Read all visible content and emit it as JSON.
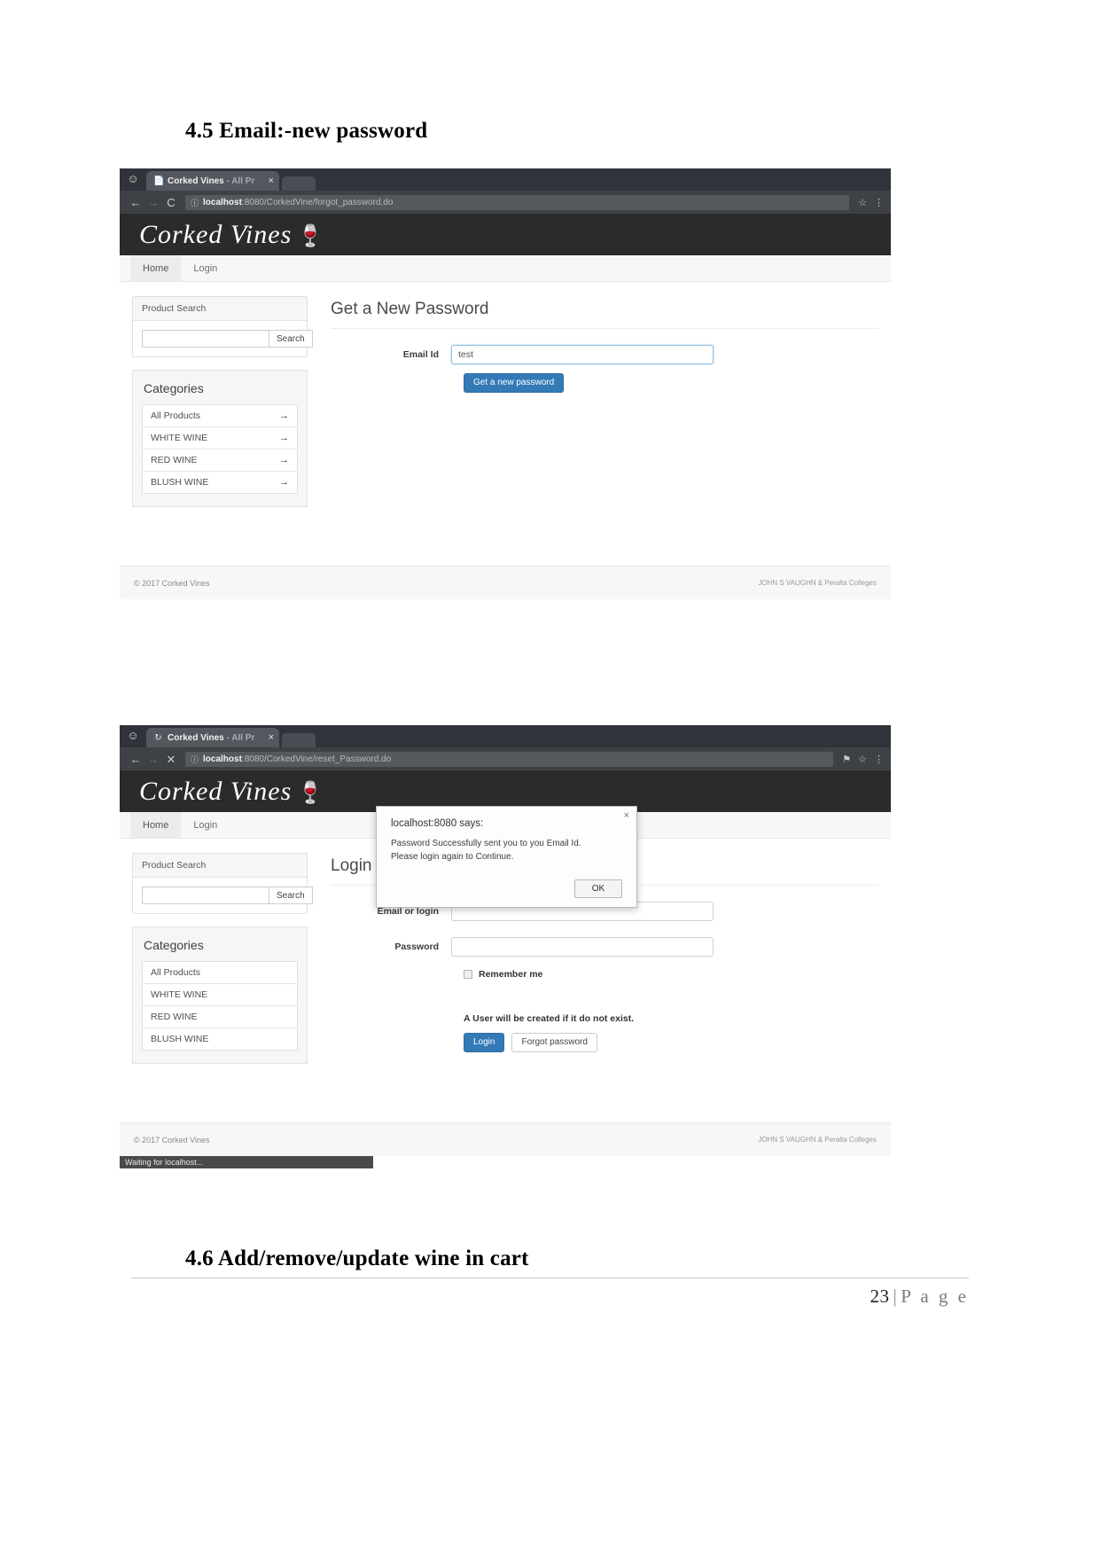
{
  "document": {
    "heading_45": "4.5 Email:-new password",
    "heading_46": "4.6 Add/remove/update wine in cart",
    "page_number": "23",
    "page_separator": "|",
    "page_word": "P a g e"
  },
  "screenshot_one": {
    "chrome": {
      "incognito_icon": "incognito-icon",
      "tab_title_main": "Corked Vines",
      "tab_title_sub": " - All Pr",
      "tab_close_label": "×",
      "back_icon": "←",
      "forward_icon": "→",
      "reload_icon": "C",
      "info_icon": "ⓘ",
      "url_host": "localhost",
      "url_path": ":8080/CorkedVine/forgot_password.do",
      "star_icon": "☆",
      "menu_icon": "⋮"
    },
    "site": {
      "brand": "Corked Vines",
      "brand_glass_icon": "wine-glass-icon",
      "nav": [
        {
          "label": "Home",
          "active": true
        },
        {
          "label": "Login",
          "active": false
        }
      ],
      "product_search": {
        "panel_title": "Product Search",
        "input_value": "",
        "search_button": "Search"
      },
      "categories": {
        "title": "Categories",
        "items": [
          {
            "label": "All Products",
            "arrow": "→"
          },
          {
            "label": "WHITE WINE",
            "arrow": "→"
          },
          {
            "label": "RED WINE",
            "arrow": "→"
          },
          {
            "label": "BLUSH WINE",
            "arrow": "→"
          }
        ]
      },
      "main": {
        "title": "Get a New Password",
        "email_label": "Email Id",
        "email_value": "test",
        "submit_button": "Get a new password"
      },
      "footer": {
        "left": "© 2017 Corked Vines",
        "right": "JOHN S VAUGHN & Peralta Colleges"
      }
    }
  },
  "screenshot_two": {
    "chrome": {
      "incognito_icon": "incognito-icon",
      "tab_title_main": "Corked Vines",
      "tab_title_sub": " - All Pr",
      "tab_close_label": "×",
      "tab_loading_icon": "↻",
      "back_icon": "←",
      "forward_icon": "→",
      "stop_icon": "✕",
      "info_icon": "ⓘ",
      "url_host": "localhost",
      "url_path": ":8080/CorkedVine/reset_Password.do",
      "pin_icon": "⚑",
      "star_icon": "☆",
      "menu_icon": "⋮"
    },
    "dialog": {
      "title": "localhost:8080 says:",
      "message": "Password Successfully sent you to you Email Id.\nPlease login again to Continue.",
      "ok_button": "OK",
      "close_icon": "×"
    },
    "site": {
      "brand": "Corked Vines",
      "brand_glass_icon": "wine-glass-icon",
      "nav": [
        {
          "label": "Home",
          "active": true
        },
        {
          "label": "Login",
          "active": false
        }
      ],
      "product_search": {
        "panel_title": "Product Search",
        "input_value": "",
        "search_button": "Search"
      },
      "categories": {
        "title": "Categories",
        "items": [
          {
            "label": "All Products"
          },
          {
            "label": "WHITE WINE"
          },
          {
            "label": "RED WINE"
          },
          {
            "label": "BLUSH WINE"
          }
        ]
      },
      "main": {
        "title": "Login",
        "email_label": "Email or login",
        "email_value": "",
        "password_label": "Password",
        "password_value": "",
        "remember_label": "Remember me",
        "note": "A User will be created if it do not exist.",
        "login_button": "Login",
        "forgot_button": "Forgot password"
      },
      "footer": {
        "left": "© 2017 Corked Vines",
        "right": "JOHN S VAUGHN & Peralta Colleges"
      }
    },
    "status_bar": "Waiting for localhost..."
  }
}
